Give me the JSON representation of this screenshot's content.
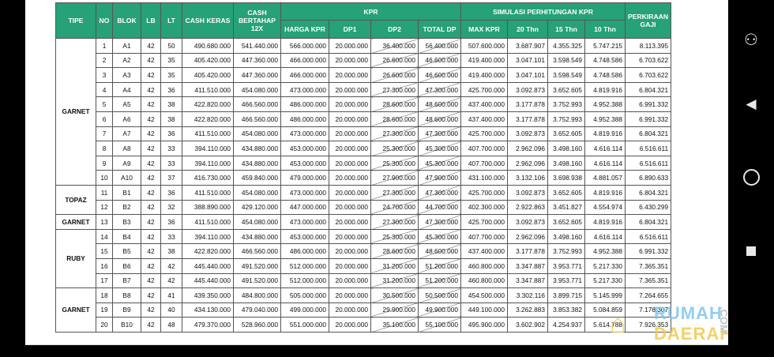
{
  "table": {
    "headers": {
      "tipe": "TIPE",
      "no": "NO",
      "blok": "BLOK",
      "lb": "LB",
      "lt": "LT",
      "cash_keras": "CASH KERAS",
      "cash_bertahap": "CASH BERTAHAP 12X",
      "kpr_group": "KPR",
      "harga_kpr": "HARGA KPR",
      "dp1": "DP1",
      "dp2": "DP2",
      "total_dp": "TOTAL DP",
      "simulasi_group": "SIMULASI PERHITUNGAN KPR",
      "max_kpr": "MAX KPR",
      "t20": "20 Thn",
      "t15": "15 Thn",
      "t10": "10 Thn",
      "gaji": "PERKIRAAN GAJI"
    },
    "groups": [
      {
        "tipe": "GARNET",
        "span": 10
      },
      {
        "tipe": "TOPAZ",
        "span": 2
      },
      {
        "tipe": "GARNET",
        "span": 1
      },
      {
        "tipe": "RUBY",
        "span": 4
      },
      {
        "tipe": "GARNET",
        "span": 3
      }
    ],
    "rows": [
      [
        "1",
        "A1",
        "42",
        "50",
        "490.680.000",
        "541.440.000",
        "566.000.000",
        "20.000.000",
        "36.400.000",
        "56.400.000",
        "507.600.000",
        "3.687.907",
        "4.355.325",
        "5.747.215",
        "8.113.395"
      ],
      [
        "2",
        "A2",
        "42",
        "35",
        "405.420.000",
        "447.360.000",
        "466.000.000",
        "20.000.000",
        "26.600.000",
        "46.600.000",
        "419.400.000",
        "3.047.101",
        "3.598.549",
        "4.748.586",
        "6.703.622"
      ],
      [
        "3",
        "A3",
        "42",
        "35",
        "405.420.000",
        "447.360.000",
        "466.000.000",
        "20.000.000",
        "26.600.000",
        "46.600.000",
        "419.400.000",
        "3.047.101",
        "3.598.549",
        "4.748.586",
        "6.703.622"
      ],
      [
        "4",
        "A4",
        "42",
        "36",
        "411.510.000",
        "454.080.000",
        "473.000.000",
        "20.000.000",
        "27.300.000",
        "47.300.000",
        "425.700.000",
        "3.092.873",
        "3.652.605",
        "4.819.916",
        "6.804.321"
      ],
      [
        "5",
        "A5",
        "42",
        "38",
        "422.820.000",
        "466.560.000",
        "486.000.000",
        "20.000.000",
        "28.600.000",
        "48.600.000",
        "437.400.000",
        "3.177.878",
        "3.752.993",
        "4.952.388",
        "6.991.332"
      ],
      [
        "6",
        "A6",
        "42",
        "38",
        "422.820.000",
        "466.560.000",
        "486.000.000",
        "20.000.000",
        "28.600.000",
        "48.600.000",
        "437.400.000",
        "3.177.878",
        "3.752.993",
        "4.952.388",
        "6.991.332"
      ],
      [
        "7",
        "A7",
        "42",
        "36",
        "411.510.000",
        "454.080.000",
        "473.000.000",
        "20.000.000",
        "27.300.000",
        "47.300.000",
        "425.700.000",
        "3.092.873",
        "3.652.605",
        "4.819.916",
        "6.804.321"
      ],
      [
        "8",
        "A8",
        "42",
        "33",
        "394.110.000",
        "434.880.000",
        "453.000.000",
        "20.000.000",
        "25.300.000",
        "45.300.000",
        "407.700.000",
        "2.962.096",
        "3.498.160",
        "4.616.114",
        "6.516.611"
      ],
      [
        "9",
        "A9",
        "42",
        "33",
        "394.110.000",
        "434.880.000",
        "453.000.000",
        "20.000.000",
        "25.300.000",
        "45.300.000",
        "407.700.000",
        "2.962.096",
        "3.498.160",
        "4.616.114",
        "6.516.611"
      ],
      [
        "10",
        "A10",
        "42",
        "37",
        "416.730.000",
        "459.840.000",
        "479.000.000",
        "20.000.000",
        "27.900.000",
        "47.900.000",
        "431.100.000",
        "3.132.106",
        "3.698.938",
        "4.881.057",
        "6.890.633"
      ],
      [
        "11",
        "B1",
        "42",
        "36",
        "411.510.000",
        "454.080.000",
        "473.000.000",
        "20.000.000",
        "27.300.000",
        "47.300.000",
        "425.700.000",
        "3.092.873",
        "3.652.605",
        "4.819.916",
        "6.804.321"
      ],
      [
        "12",
        "B2",
        "42",
        "32",
        "388.890.000",
        "429.120.000",
        "447.000.000",
        "20.000.000",
        "24.700.000",
        "44.700.000",
        "402.300.000",
        "2.922.863",
        "3.451.827",
        "4.554.974",
        "6.430.299"
      ],
      [
        "13",
        "B3",
        "42",
        "36",
        "411.510.000",
        "454.080.000",
        "473.000.000",
        "20.000.000",
        "27.300.000",
        "47.300.000",
        "425.700.000",
        "3.092.873",
        "3.652.605",
        "4.819.916",
        "6.804.321"
      ],
      [
        "14",
        "B4",
        "42",
        "33",
        "394.110.000",
        "434.880.000",
        "453.000.000",
        "20.000.000",
        "25.300.000",
        "45.300.000",
        "407.700.000",
        "2.962.096",
        "3.498.160",
        "4.616.114",
        "6.516.611"
      ],
      [
        "15",
        "B5",
        "42",
        "38",
        "422.820.000",
        "466.560.000",
        "486.000.000",
        "20.000.000",
        "28.600.000",
        "48.600.000",
        "437.400.000",
        "3.177.878",
        "3.752.993",
        "4.952.388",
        "6.991.332"
      ],
      [
        "16",
        "B6",
        "42",
        "42",
        "445.440.000",
        "491.520.000",
        "512.000.000",
        "20.000.000",
        "31.200.000",
        "51.200.000",
        "460.800.000",
        "3.347.887",
        "3.953.771",
        "5.217.330",
        "7.365.351"
      ],
      [
        "17",
        "B7",
        "42",
        "42",
        "445.440.000",
        "491.520.000",
        "512.000.000",
        "20.000.000",
        "31.200.000",
        "51.200.000",
        "460.800.000",
        "3.347.887",
        "3.953.771",
        "5.217.330",
        "7.365.351"
      ],
      [
        "18",
        "B8",
        "42",
        "41",
        "439.350.000",
        "484.800.000",
        "505.000.000",
        "20.000.000",
        "30.500.000",
        "50.500.000",
        "454.500.000",
        "3.302.116",
        "3.899.715",
        "5.145.999",
        "7.264.655"
      ],
      [
        "19",
        "B9",
        "42",
        "40",
        "434.130.000",
        "479.040.000",
        "499.000.000",
        "20.000.000",
        "29.900.000",
        "49.900.000",
        "449.100.000",
        "3.262.883",
        "3.853.382",
        "5.084.859",
        "7.178.307"
      ],
      [
        "20",
        "B10",
        "42",
        "48",
        "479.370.000",
        "528.960.000",
        "551.000.000",
        "20.000.000",
        "35.100.000",
        "55.100.000",
        "495.900.000",
        "3.602.902",
        "4.254.937",
        "5.614.788",
        "7.926.353"
      ]
    ]
  },
  "watermark": {
    "line1": "RUMAH",
    "line2": "DAERAH",
    "tld": ".COM"
  },
  "colors": {
    "header_bg": "#26a178",
    "header_text": "#ffffff",
    "grid": "#555555"
  },
  "icons": {
    "accessibility": "accessibility-icon",
    "back": "back-icon",
    "home": "home-icon",
    "recent": "recent-apps-icon"
  }
}
